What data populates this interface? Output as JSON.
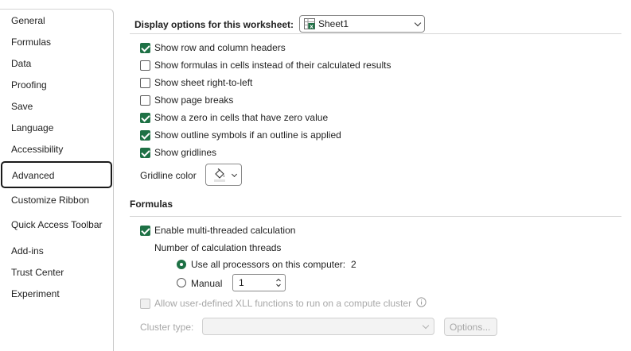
{
  "sidebar": {
    "items": [
      {
        "label": "General"
      },
      {
        "label": "Formulas"
      },
      {
        "label": "Data"
      },
      {
        "label": "Proofing"
      },
      {
        "label": "Save"
      },
      {
        "label": "Language"
      },
      {
        "label": "Accessibility"
      },
      {
        "label": "Advanced",
        "selected": true
      },
      {
        "label": "Customize Ribbon"
      },
      {
        "label": "Quick Access Toolbar"
      },
      {
        "label": "Add-ins"
      },
      {
        "label": "Trust Center"
      },
      {
        "label": "Experiment"
      }
    ]
  },
  "worksheet": {
    "title": "Display options for this worksheet:",
    "sheet_select": "Sheet1",
    "options": [
      {
        "label": "Show row and column headers",
        "checked": true
      },
      {
        "label": "Show formulas in cells instead of their calculated results",
        "checked": false
      },
      {
        "label": "Show sheet right-to-left",
        "checked": false
      },
      {
        "label": "Show page breaks",
        "checked": false
      },
      {
        "label": "Show a zero in cells that have zero value",
        "checked": true
      },
      {
        "label": "Show outline symbols if an outline is applied",
        "checked": true
      },
      {
        "label": "Show gridlines",
        "checked": true
      }
    ],
    "gridline_color_label": "Gridline color"
  },
  "formulas": {
    "title": "Formulas",
    "multithread_label": "Enable multi-threaded calculation",
    "multithread_checked": true,
    "threads_label": "Number of calculation threads",
    "use_all_label": "Use all processors on this computer:",
    "use_all_value": "2",
    "manual_label": "Manual",
    "manual_value": "1",
    "xll_label": "Allow user-defined XLL functions to run on a compute cluster",
    "cluster_type_label": "Cluster type:",
    "options_button": "Options..."
  },
  "colors": {
    "accent": "#1e7145",
    "selected_border": "#1a1a1a"
  },
  "icons": {
    "sheet": "excel-sheet-icon",
    "paint_bucket": "paint-bucket-icon",
    "info": "info-icon"
  }
}
